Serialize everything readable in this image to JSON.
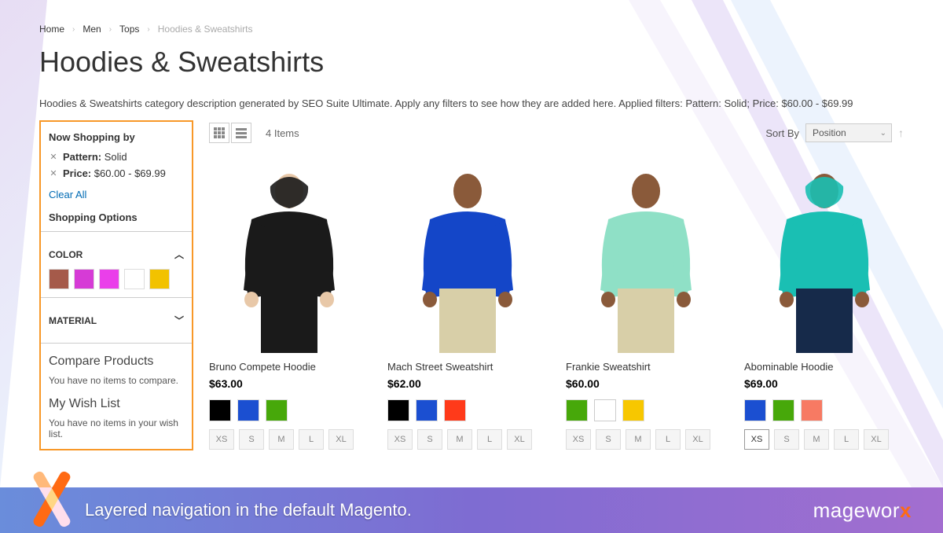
{
  "breadcrumbs": {
    "home": "Home",
    "men": "Men",
    "tops": "Tops",
    "current": "Hoodies & Sweatshirts"
  },
  "page_title": "Hoodies & Sweatshirts",
  "category_description": "Hoodies & Sweatshirts category description generated by SEO Suite Ultimate. Apply any filters to see how they are added here. Applied filters: Pattern: Solid; Price: $60.00 - $69.99",
  "sidebar": {
    "now_shopping_title": "Now Shopping by",
    "applied": [
      {
        "label": "Pattern:",
        "value": "Solid"
      },
      {
        "label": "Price:",
        "value": "$60.00 - $69.99"
      }
    ],
    "clear_all": "Clear All",
    "shopping_options_title": "Shopping Options",
    "filters": {
      "color_label": "COLOR",
      "color_swatches": [
        "#a55a4a",
        "#d63bd6",
        "#ea3fea",
        "#ffffff",
        "#f2c200"
      ],
      "material_label": "MATERIAL"
    },
    "compare_title": "Compare Products",
    "compare_msg": "You have no items to compare.",
    "wish_title": "My Wish List",
    "wish_msg": "You have no items in your wish list."
  },
  "toolbar": {
    "count": "4 Items",
    "sort_label": "Sort By",
    "sort_value": "Position"
  },
  "sizes": [
    "XS",
    "S",
    "M",
    "L",
    "XL"
  ],
  "products": [
    {
      "name": "Bruno Compete Hoodie",
      "price": "$63.00",
      "colors": [
        "#000000",
        "#1b4fd1",
        "#47a80a"
      ],
      "selected_color": null,
      "selected_size": null
    },
    {
      "name": "Mach Street Sweatshirt",
      "price": "$62.00",
      "colors": [
        "#000000",
        "#1b4fd1",
        "#ff3a1a"
      ],
      "selected_color": null,
      "selected_size": null
    },
    {
      "name": "Frankie Sweatshirt",
      "price": "$60.00",
      "colors": [
        "#47a80a",
        "#ffffff",
        "#f7c700"
      ],
      "selected_color": null,
      "selected_size": null
    },
    {
      "name": "Abominable Hoodie",
      "price": "$69.00",
      "colors": [
        "#1b4fd1",
        "#47a80a",
        "#f77a63"
      ],
      "selected_color": null,
      "selected_size": "XS"
    }
  ],
  "footer": {
    "caption": "Layered navigation in the default Magento.",
    "brand_a": "magewor",
    "brand_b": "x"
  }
}
